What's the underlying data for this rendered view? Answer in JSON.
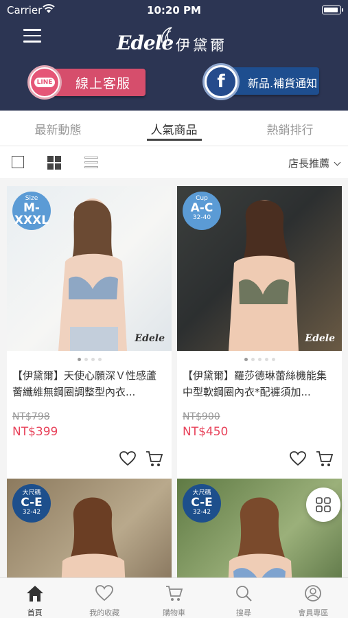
{
  "status_bar": {
    "carrier": "Carrier",
    "time": "10:20 PM"
  },
  "brand": {
    "script_name": "Edele",
    "cjk_name": "伊黛爾"
  },
  "promo_buttons": {
    "line": {
      "icon_text": "LINE",
      "label": "線上客服"
    },
    "facebook": {
      "icon_text": "f",
      "label": "新品.補貨通知"
    }
  },
  "tabs": [
    {
      "label": "最新動態",
      "active": false
    },
    {
      "label": "人氣商品",
      "active": true
    },
    {
      "label": "熱銷排行",
      "active": false
    }
  ],
  "toolbar": {
    "sort_label": "店長推薦"
  },
  "products": [
    {
      "badge_top": "Size",
      "badge_main": "M-XXXL",
      "badge_sub": "",
      "badge_color": "#5b9bd5",
      "logo": "Edele",
      "title": "【伊黛爾】天使心願深Ｖ性感蘆薈纖維無鋼圈調整型內衣...",
      "old_price": "NT$798",
      "price": "NT$399"
    },
    {
      "badge_top": "Cup",
      "badge_main": "A-C",
      "badge_sub": "32-40",
      "badge_color": "#5b9bd5",
      "logo": "Edele",
      "title": "【伊黛爾】羅莎德琳蕾絲機能集中型軟鋼圈內衣*配褲須加...",
      "old_price": "NT$900",
      "price": "NT$450"
    },
    {
      "badge_top": "大尺碼",
      "badge_main": "C-E",
      "badge_sub": "32-42",
      "badge_color": "#1d4f8c",
      "logo": "",
      "title": "",
      "old_price": "",
      "price": ""
    },
    {
      "badge_top": "大尺碼",
      "badge_main": "C-E",
      "badge_sub": "32-42",
      "badge_color": "#1d4f8c",
      "logo": "",
      "title": "",
      "old_price": "",
      "price": ""
    }
  ],
  "bottom_nav": [
    {
      "label": "首頁",
      "icon": "home-icon",
      "active": true
    },
    {
      "label": "我的收藏",
      "icon": "heart-icon",
      "active": false
    },
    {
      "label": "購物車",
      "icon": "cart-icon",
      "active": false
    },
    {
      "label": "搜尋",
      "icon": "search-icon",
      "active": false
    },
    {
      "label": "會員專區",
      "icon": "user-icon",
      "active": false
    }
  ],
  "colors": {
    "header_bg": "#2c3553",
    "line_pink": "#d64e6c",
    "facebook_blue": "#1e4e8f",
    "price_red": "#e8425a"
  }
}
